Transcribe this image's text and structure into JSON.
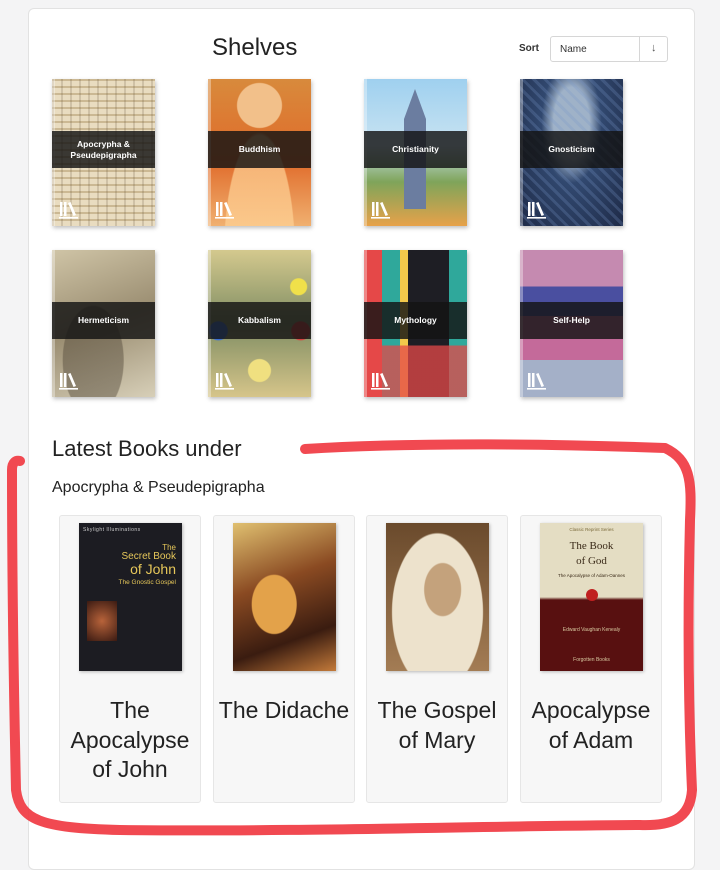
{
  "shelves_heading": "Shelves",
  "sort": {
    "label": "Sort",
    "value": "Name",
    "direction_glyph": "↓"
  },
  "shelves": [
    {
      "name": "Apocrypha & Pseudepigrapha",
      "icon": "library-icon",
      "colors": [
        "#e9dcc0",
        "#b59f7c"
      ]
    },
    {
      "name": "Buddhism",
      "icon": "library-icon",
      "colors": [
        "#e5a35a",
        "#b4562a"
      ]
    },
    {
      "name": "Christianity",
      "icon": "library-icon",
      "colors": [
        "#8cc3e6",
        "#6e8f4c"
      ]
    },
    {
      "name": "Gnosticism",
      "icon": "library-icon",
      "colors": [
        "#34507d",
        "#16223a"
      ]
    },
    {
      "name": "Hermeticism",
      "icon": "library-icon",
      "colors": [
        "#c4b89a",
        "#8a7d63"
      ]
    },
    {
      "name": "Kabbalism",
      "icon": "library-icon",
      "colors": [
        "#d8c890",
        "#6e7b5a"
      ]
    },
    {
      "name": "Mythology",
      "icon": "library-icon",
      "colors": [
        "#e64b4b",
        "#2aa59a"
      ]
    },
    {
      "name": "Self-Help",
      "icon": "library-icon",
      "colors": [
        "#c07aa3",
        "#3a3c84"
      ]
    }
  ],
  "latest": {
    "heading": "Latest Books under",
    "shelf": "Apocrypha & Pseudepigrapha",
    "books": [
      {
        "title": "The Apocalypse of John",
        "cover_text": {
          "series": "Skylight Illuminations",
          "line1": "The",
          "line2": "Secret Book",
          "line3": "of John",
          "line4": "The Gnostic Gospel"
        },
        "colors": [
          "#1c1c22",
          "#caa63a"
        ]
      },
      {
        "title": "The Didache",
        "colors": [
          "#7d3a1c",
          "#e0a33e"
        ]
      },
      {
        "title": "The Gospel of Mary",
        "colors": [
          "#8b6a48",
          "#d9c6a6"
        ]
      },
      {
        "title": "Apocalypse of Adam",
        "cover_text": {
          "series": "Classic Reprint Series",
          "line1": "The Book",
          "line2": "of God",
          "sub": "The Apocalypse of Adam-Oannes",
          "author": "Edward Vaughan Kenealy",
          "publisher": "Forgotten Books"
        },
        "colors": [
          "#e2dcc2",
          "#5a1010"
        ]
      }
    ]
  }
}
